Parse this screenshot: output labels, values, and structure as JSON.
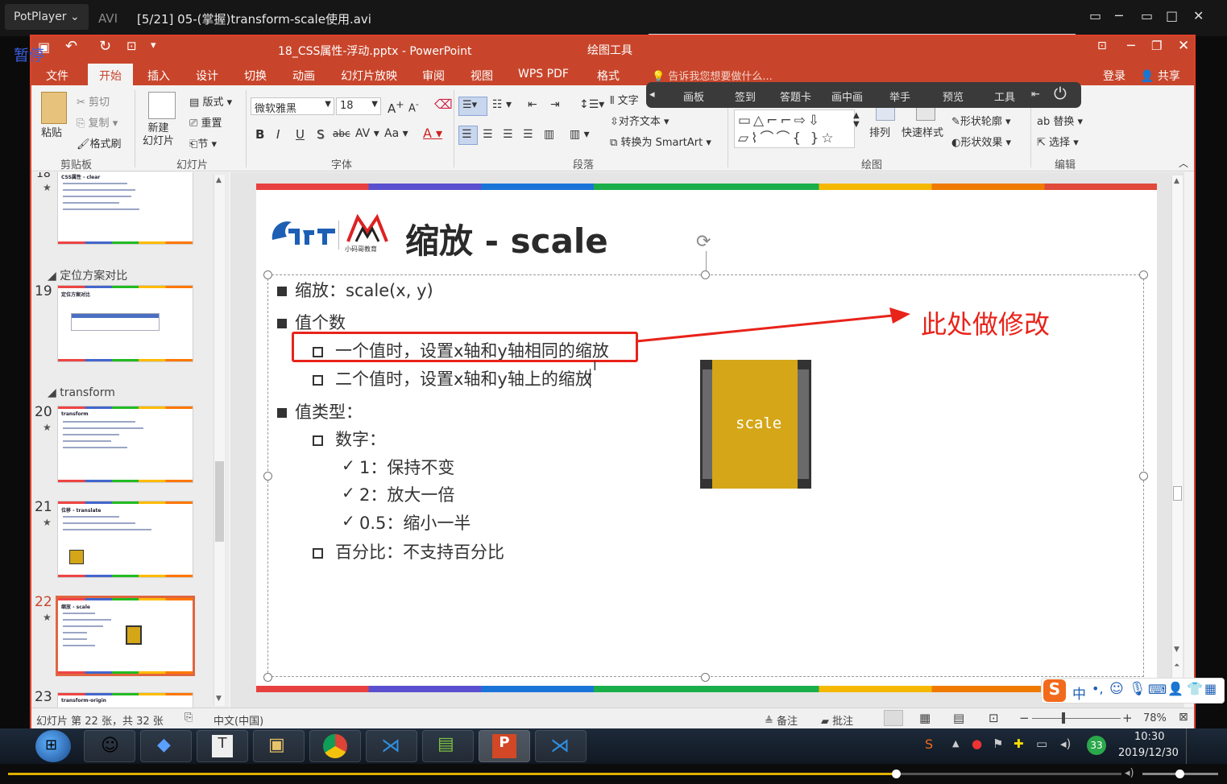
{
  "player": {
    "brand": "PotPlayer",
    "format": "AVI",
    "file_title": "[5/21] 05-(掌握)transform-scale使用.avi",
    "pause_label": "暂停"
  },
  "ppt": {
    "title": "18_CSS属性-浮动.pptx - PowerPoint",
    "drawing_tools": "绘图工具",
    "tabs": [
      "文件",
      "开始",
      "插入",
      "设计",
      "切换",
      "动画",
      "幻灯片放映",
      "审阅",
      "视图",
      "WPS PDF",
      "格式"
    ],
    "tellme": "告诉我您想要做什么...",
    "login": "登录",
    "share": "共享"
  },
  "ribbon": {
    "clipboard": {
      "paste": "粘贴",
      "cut": "剪切",
      "copy": "复制",
      "format_painter": "格式刷",
      "label": "剪贴板"
    },
    "slides": {
      "new": "新建\n幻灯片",
      "layout": "版式",
      "reset": "重置",
      "section": "节",
      "label": "幻灯片"
    },
    "font": {
      "name": "微软雅黑",
      "size": "18",
      "label": "字体"
    },
    "paragraph": {
      "align_text": "对齐文本",
      "smartart": "转换为 SmartArt",
      "text_dir": "文字",
      "label": "段落"
    },
    "drawing": {
      "arrange": "排列",
      "quick_styles": "快速样式",
      "outline": "形状轮廓",
      "effects": "形状效果",
      "label": "绘图"
    },
    "editing": {
      "replace": "替换",
      "select": "选择",
      "label": "编辑"
    }
  },
  "floating_toolbar": [
    "画板",
    "签到",
    "答题卡",
    "画中画",
    "举手",
    "预览",
    "工具"
  ],
  "thumbnails": {
    "sections": [
      "定位方案对比",
      "transform"
    ],
    "items": [
      {
        "num": "18",
        "title": "CSS属性 - clear"
      },
      {
        "num": "19",
        "title": "定位方案对比"
      },
      {
        "num": "20",
        "title": "transform"
      },
      {
        "num": "21",
        "title": "位移 - translate"
      },
      {
        "num": "22",
        "title": "缩放 - scale"
      },
      {
        "num": "23",
        "title": "transform-origin"
      }
    ]
  },
  "slide": {
    "title": "缩放 - scale",
    "bullets": {
      "b1": "缩放：scale(x, y)",
      "b2": "值个数",
      "b2a": "一个值时，设置x轴和y轴相同的缩放",
      "b2b": "二个值时，设置x轴和y轴上的缩放",
      "b3": "值类型：",
      "b3a": "数字：",
      "b3a1": "1：保持不变",
      "b3a2": "2：放大一倍",
      "b3a3": "0.5：缩小一半",
      "b3b": "百分比：不支持百分比"
    },
    "annotation": "此处做修改",
    "box_label": "scale",
    "logo_text": "小码哥教育"
  },
  "colors": {
    "ppt_red": "#c8452b",
    "annotation_red": "#e8231a",
    "box_gold": "#d4a618"
  },
  "statusbar": {
    "slide_info": "幻灯片 第 22 张，共 32 张",
    "language": "中文(中国)",
    "notes": "备注",
    "comments": "批注",
    "zoom": "78%"
  },
  "taskbar": {
    "time": "10:30",
    "date": "2019/12/30",
    "badge": "33",
    "ime": "中"
  }
}
